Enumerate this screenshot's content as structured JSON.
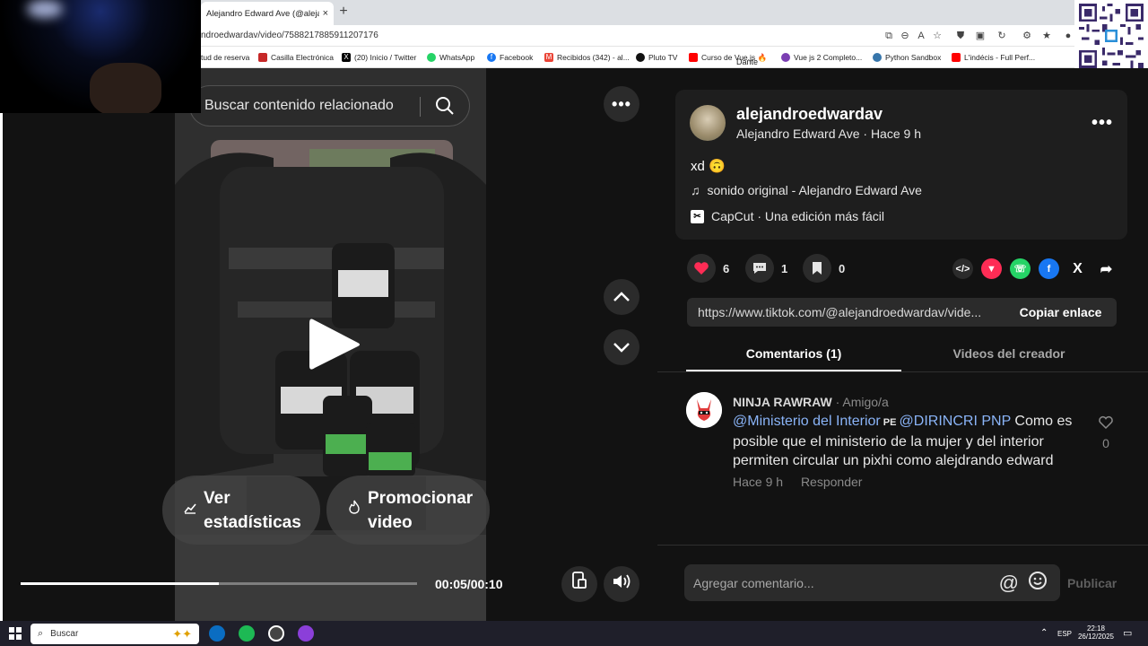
{
  "browser": {
    "tab_title": "Alejandro Edward Ave (@alejandro",
    "tab_close": "×",
    "new_tab": "+",
    "url": "ndroedwardav/video/7588217885911207176",
    "bookmarks": [
      {
        "label": "tud de reserva",
        "color": "#ffffff"
      },
      {
        "label": "Casilla Electrónica",
        "color": "#c62828"
      },
      {
        "label": "(20) Inicio / Twitter",
        "color": "#000000"
      },
      {
        "label": "WhatsApp",
        "color": "#25d366"
      },
      {
        "label": "Facebook",
        "color": "#1877f2"
      },
      {
        "label": "Recibidos (342) - al...",
        "color": "#ea4335"
      },
      {
        "label": "Pluto TV",
        "color": "#111111"
      },
      {
        "label": "Curso de Vue.js 🔥",
        "color": "#ff0000"
      },
      {
        "label": "Dante",
        "color": "#ffffff"
      },
      {
        "label": "Vue js 2 Completo...",
        "color": "#7b3fb2"
      },
      {
        "label": "Python Sandbox",
        "color": "#3776ab"
      },
      {
        "label": "L'indécis - Full Perf...",
        "color": "#ff0000"
      }
    ]
  },
  "video": {
    "search_placeholder": "Buscar contenido relacionado",
    "more_icon": "more-horizontal-icon",
    "stats_button_line1": "Ver",
    "stats_button_line2": "estadísticas",
    "promote_button_line1": "Promocionar",
    "promote_button_line2": "video",
    "time": "00:05/00:10",
    "progress": 0.5
  },
  "post": {
    "username": "alejandroedwardav",
    "subtitle": "Alejandro Edward Ave · Hace 9 h",
    "description": "xd 🙃",
    "music": "sonido original - Alejandro Edward Ave",
    "capcut": "CapCut · Una edición más fácil",
    "likes": "6",
    "comments": "1",
    "saves": "0",
    "link": "https://www.tiktok.com/@alejandroedwardav/vide...",
    "copy_link": "Copiar enlace",
    "tab_comments": "Comentarios (1)",
    "tab_creator": "Videos del creador"
  },
  "comment": {
    "author": "NINJA RAWRAW",
    "relation": " · Amigo/a",
    "mention1": "@Ministerio del Interior",
    "flag": " PE ",
    "mention2": "@DIRINCRI PNP",
    "text": " Como es posible que el ministerio de la mujer y del interior permiten circular un pixhi como alejdrando edward",
    "time": "Hace 9 h",
    "reply": "Responder",
    "like_count": "0"
  },
  "composer": {
    "placeholder": "Agregar comentario...",
    "publish": "Publicar"
  },
  "taskbar": {
    "search": "Buscar",
    "lang": "ESP",
    "clock_time": "22:18",
    "clock_date": "26/12/2025"
  },
  "colors": {
    "like_red": "#fe2c55",
    "mention_blue": "#8ab4f8",
    "whatsapp": "#25d366",
    "facebook": "#1877f2"
  }
}
